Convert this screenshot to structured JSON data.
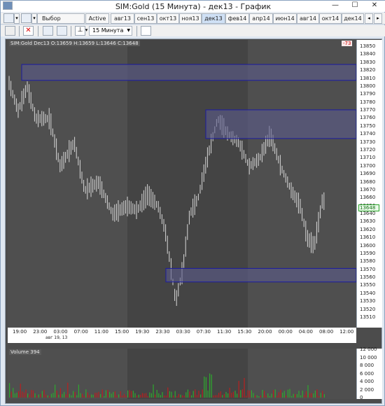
{
  "window": {
    "title": "SIM:Gold (15 Минута) - дек13 - График",
    "minimize": "—",
    "maximize": "☐",
    "close": "✕"
  },
  "toolbar": {
    "strategy_label": "Выбор Стратегии",
    "active_label": "Active",
    "tabs": [
      "авг13",
      "сен13",
      "окт13",
      "ноя13",
      "дек13",
      "фев14",
      "апр14",
      "июн14",
      "авг14",
      "окт14",
      "дек14"
    ],
    "active_tab": "дек13",
    "timeframe": "15 Минута"
  },
  "chart": {
    "info_text": "SIM:Gold Dec13 O:13659 H:13659 L:13646 C:13648",
    "badge_text": "-73",
    "last_price": "13648",
    "price_ticks": [
      "13850",
      "13840",
      "13830",
      "13820",
      "13810",
      "13800",
      "13790",
      "13780",
      "13770",
      "13760",
      "13750",
      "13740",
      "13730",
      "13720",
      "13710",
      "13700",
      "13690",
      "13680",
      "13670",
      "13660",
      "13650",
      "13640",
      "13630",
      "13620",
      "13610",
      "13600",
      "13590",
      "13580",
      "13570",
      "13560",
      "13550",
      "13540",
      "13530",
      "13520",
      "13510"
    ],
    "time_ticks": [
      "19:00",
      "23:00",
      "03:00",
      "07:00",
      "11:00",
      "15:00",
      "19:30",
      "23:30",
      "03:30",
      "07:30",
      "11:30",
      "15:30",
      "20:00",
      "00:00",
      "04:00",
      "08:00",
      "12:00"
    ],
    "date_tick": "авг 19, 13"
  },
  "volume": {
    "label": "Volume 394",
    "ticks": [
      "12 000",
      "10 000",
      "8 000",
      "6 000",
      "4 000",
      "2 000",
      "0"
    ]
  },
  "colors": {
    "chart_bg": "#4f4f4f",
    "session_shade": "#444444",
    "bars": "#d8d8d8",
    "zone_fill": "#5c5c8c",
    "zone_border": "#1a1aa0",
    "vol_up": "#2ea82e",
    "vol_down": "#b82020"
  }
}
